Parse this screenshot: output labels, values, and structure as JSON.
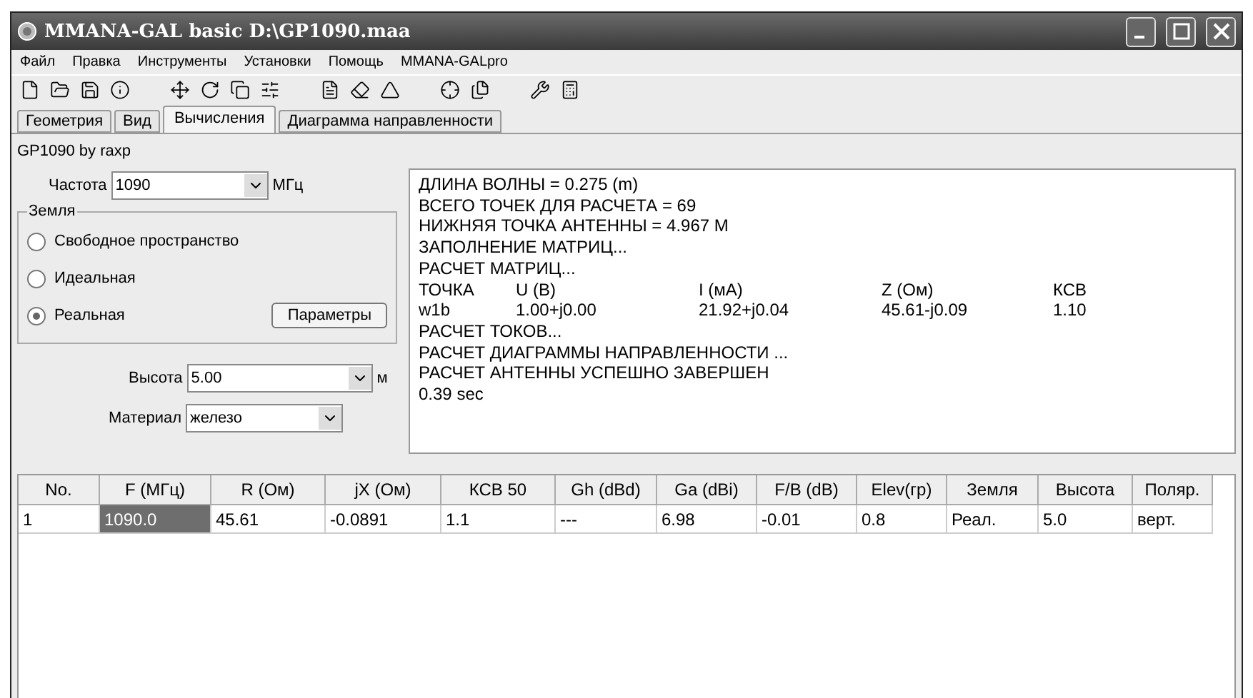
{
  "window": {
    "title": "MMANA-GAL basic D:\\GP1090.maa"
  },
  "menu": [
    "Файл",
    "Правка",
    "Инструменты",
    "Установки",
    "Помощь",
    "MMANA-GALpro"
  ],
  "tabs": [
    {
      "label": "Геометрия",
      "selected": false
    },
    {
      "label": "Вид",
      "selected": false
    },
    {
      "label": "Вычисления",
      "selected": true
    },
    {
      "label": "Диаграмма направленности",
      "selected": false
    }
  ],
  "antenna_name": "GP1090 by raxp",
  "frequency": {
    "label": "Частота",
    "value": "1090",
    "unit": "МГц"
  },
  "ground": {
    "title": "Земля",
    "options": [
      {
        "label": "Свободное пространство",
        "selected": false
      },
      {
        "label": "Идеальная",
        "selected": false
      },
      {
        "label": "Реальная",
        "selected": true
      }
    ],
    "button": "Параметры"
  },
  "height": {
    "label": "Высота",
    "value": "5.00",
    "unit": "м"
  },
  "material": {
    "label": "Материал",
    "value": "железо"
  },
  "log": [
    {
      "kind": "text",
      "text": "ДЛИНА ВОЛНЫ = 0.275 (m)"
    },
    {
      "kind": "text",
      "text": "ВСЕГО ТОЧЕК ДЛЯ РАСЧЕТА = 69"
    },
    {
      "kind": "text",
      "text": "НИЖНЯЯ ТОЧКА АНТЕННЫ = 4.967 М"
    },
    {
      "kind": "text",
      "text": "ЗАПОЛНЕНИЕ МАТРИЦ..."
    },
    {
      "kind": "text",
      "text": "РАСЧЕТ МАТРИЦ..."
    },
    {
      "kind": "row",
      "cells": [
        "ТОЧКА",
        "U (B)",
        "I (мА)",
        "Z (Ом)",
        "КСВ"
      ]
    },
    {
      "kind": "row",
      "cells": [
        "w1b",
        "1.00+j0.00",
        "21.92+j0.04",
        "45.61-j0.09",
        "1.10"
      ]
    },
    {
      "kind": "text",
      "text": "РАСЧЕТ ТОКОВ..."
    },
    {
      "kind": "text",
      "text": "РАСЧЕТ ДИАГРАММЫ НАПРАВЛЕННОСТИ ..."
    },
    {
      "kind": "text",
      "text": "РАСЧЕТ АНТЕННЫ УСПЕШНО ЗАВЕРШЕН"
    },
    {
      "kind": "text",
      "text": "0.39 sec"
    }
  ],
  "table": {
    "columns": [
      "No.",
      "F (МГц)",
      "R (Ом)",
      "jX (Ом)",
      "КСВ 50",
      "Gh (dBd)",
      "Ga (dBi)",
      "F/B (dB)",
      "Elev(гр)",
      "Земля",
      "Высота",
      "Поляр."
    ],
    "rows": [
      {
        "cells": [
          {
            "text": "1",
            "selected": false
          },
          {
            "text": "1090.0",
            "selected": true
          },
          {
            "text": "45.61",
            "selected": false
          },
          {
            "text": "-0.0891",
            "selected": false
          },
          {
            "text": "1.1",
            "selected": false
          },
          {
            "text": "---",
            "selected": false
          },
          {
            "text": "6.98",
            "selected": false
          },
          {
            "text": "-0.01",
            "selected": false
          },
          {
            "text": "0.8",
            "selected": false
          },
          {
            "text": "Реал.",
            "selected": false
          },
          {
            "text": "5.0",
            "selected": false
          },
          {
            "text": "верт.",
            "selected": false
          }
        ]
      }
    ]
  }
}
